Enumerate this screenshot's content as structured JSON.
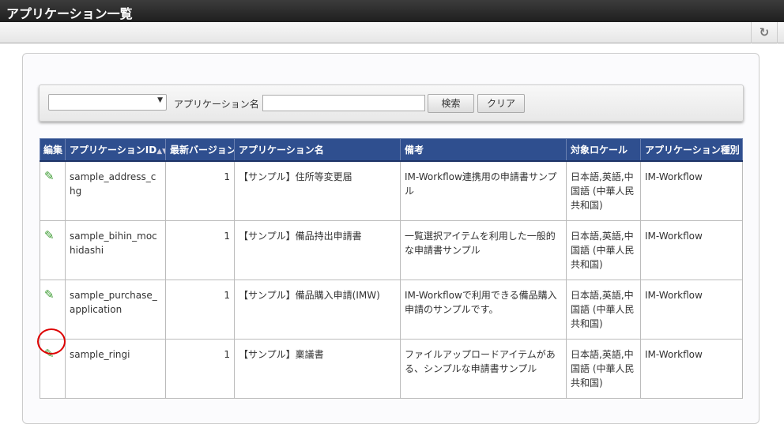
{
  "title": "アプリケーション一覧",
  "toolbar": {
    "refresh_icon": "refresh-icon"
  },
  "search": {
    "select_value": "",
    "label": "アプリケーション名",
    "input_value": "",
    "search_button": "検索",
    "clear_button": "クリア"
  },
  "table": {
    "headers": [
      "編集",
      "アプリケーションID",
      "最新バージョン",
      "アプリケーション名",
      "備考",
      "対象ロケール",
      "アプリケーション種別"
    ],
    "rows": [
      {
        "id": "sample_address_chg",
        "version": "1",
        "name": "【サンプル】住所等変更届",
        "remark": "IM-Workflow連携用の申請書サンプル",
        "locale": "日本語,英語,中国語 (中華人民共和国)",
        "type": "IM-Workflow"
      },
      {
        "id": "sample_bihin_mochidashi",
        "version": "1",
        "name": "【サンプル】備品持出申請書",
        "remark": "一覧選択アイテムを利用した一般的な申請書サンプル",
        "locale": "日本語,英語,中国語 (中華人民共和国)",
        "type": "IM-Workflow"
      },
      {
        "id": "sample_purchase_application",
        "version": "1",
        "name": "【サンプル】備品購入申請(IMW)",
        "remark": "IM-Workflowで利用できる備品購入申請のサンプルです。",
        "locale": "日本語,英語,中国語 (中華人民共和国)",
        "type": "IM-Workflow"
      },
      {
        "id": "sample_ringi",
        "version": "1",
        "name": "【サンプル】稟議書",
        "remark": "ファイルアップロードアイテムがある、シンプルな申請書サンプル",
        "locale": "日本語,英語,中国語 (中華人民共和国)",
        "type": "IM-Workflow"
      }
    ]
  },
  "highlight_color": "#dd0000"
}
